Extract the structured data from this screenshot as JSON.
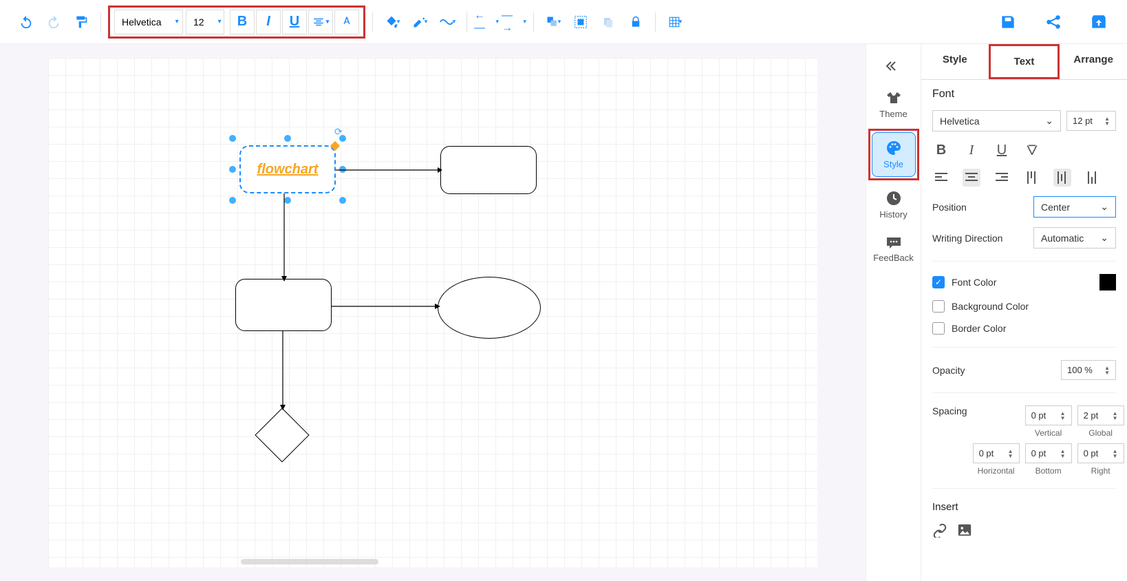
{
  "toolbar": {
    "font_family": "Helvetica",
    "font_size": "12"
  },
  "sidebar": {
    "items": [
      {
        "label": "Theme"
      },
      {
        "label": "Style"
      },
      {
        "label": "History"
      },
      {
        "label": "FeedBack"
      }
    ]
  },
  "panel": {
    "tabs": [
      "Style",
      "Text",
      "Arrange"
    ],
    "active_tab": "Text",
    "font_section": "Font",
    "font_family": "Helvetica",
    "font_size": "12 pt",
    "position_label": "Position",
    "position_value": "Center",
    "writing_dir_label": "Writing Direction",
    "writing_dir_value": "Automatic",
    "font_color_label": "Font Color",
    "bg_color_label": "Background Color",
    "border_color_label": "Border Color",
    "opacity_label": "Opacity",
    "opacity_value": "100 %",
    "spacing_label": "Spacing",
    "spacing": {
      "vertical": {
        "value": "0 pt",
        "label": "Vertical"
      },
      "global": {
        "value": "2 pt",
        "label": "Global"
      },
      "horizontal": {
        "value": "0 pt",
        "label": "Horizontal"
      },
      "bottom": {
        "value": "0 pt",
        "label": "Bottom"
      },
      "right": {
        "value": "0 pt",
        "label": "Right"
      }
    },
    "insert_label": "Insert"
  },
  "canvas": {
    "shape1_text": "flowchart"
  }
}
